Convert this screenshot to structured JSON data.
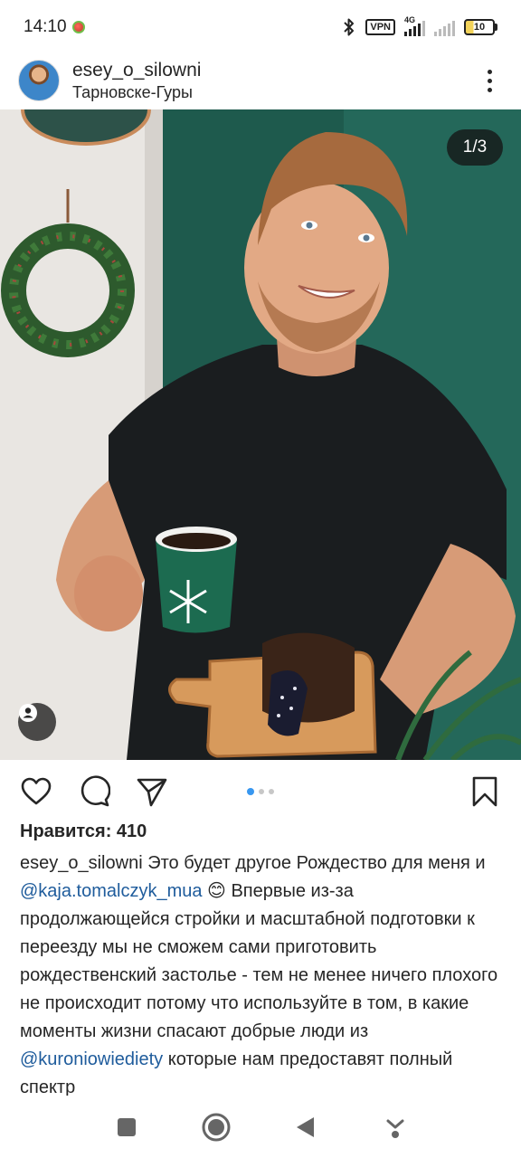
{
  "status_bar": {
    "time": "14:10",
    "vpn": "VPN",
    "network": "4G",
    "battery": "10"
  },
  "post": {
    "username": "esey_o_silowni",
    "location": "Тарновске-Гуры",
    "page_counter": "1/3",
    "carousel": {
      "current": 1,
      "total": 3
    },
    "likes": "Нравится: 410",
    "caption": {
      "author": "esey_o_silowni",
      "text1": " Это будет другое Рождество для меня и ",
      "mention1": "@kaja.tomalczyk_mua",
      "text2": " 😊 Впервые из-за продолжающейся стройки и масштабной подготовки к переезду мы не сможем сами приготовить рождественский застолье - тем не менее ничего плохого не происходит потому что используйте в том, в какие моменты жизни спасают добрые люди из ",
      "mention2": "@kuroniowiediety",
      "text3": " которые нам предоставят полный спектр"
    }
  },
  "icons": {
    "bluetooth": "bluetooth-icon",
    "more": "more-vertical-icon",
    "tag": "person-tag-icon",
    "like": "heart-icon",
    "comment": "comment-icon",
    "share": "send-icon",
    "save": "bookmark-icon",
    "nav_recent": "square-icon",
    "nav_home": "circle-icon",
    "nav_back": "triangle-back-icon",
    "nav_assist": "assist-icon"
  },
  "colors": {
    "accent_blue": "#3897f0",
    "mention": "#1f5c9c",
    "text": "#262626"
  }
}
